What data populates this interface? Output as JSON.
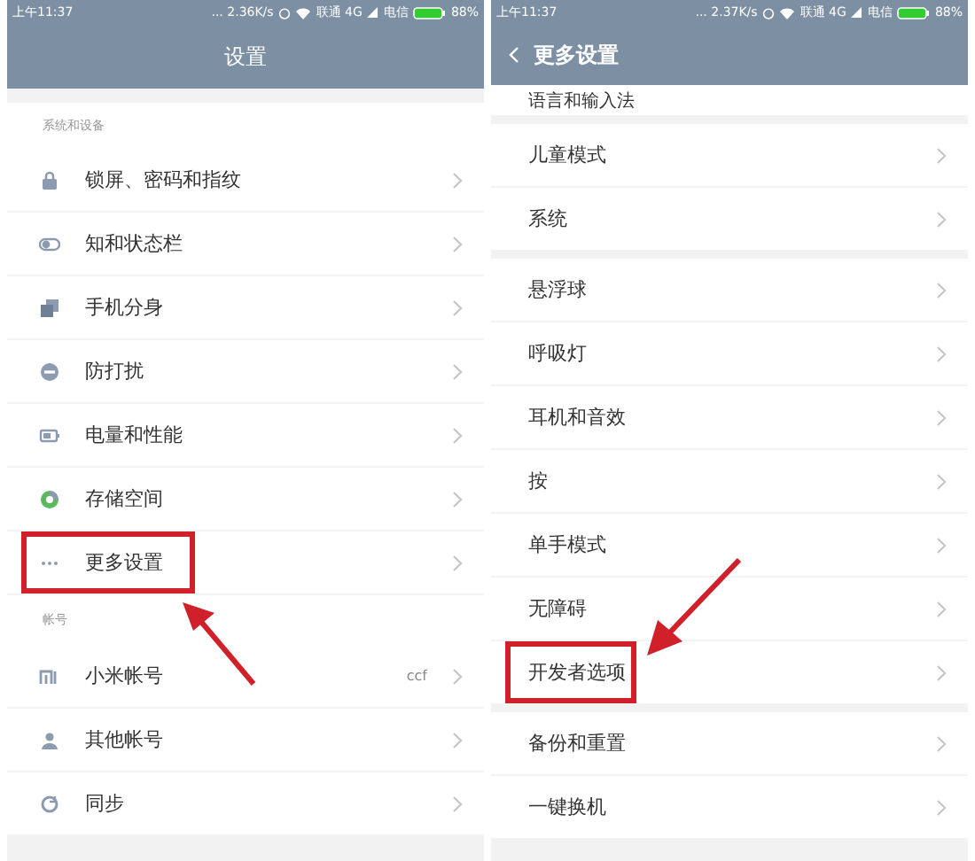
{
  "panels": [
    {
      "status_bar": {
        "time": "上午11:37",
        "speed": "... 2.36K/s",
        "carrier_1": "联通 4G",
        "carrier_2": "电信",
        "battery": "88%"
      },
      "header": {
        "title": "设置",
        "back": false
      },
      "groups": [
        {
          "heading": "系统和设备",
          "cut": false,
          "items": [
            {
              "label": "锁屏、密码和指纹",
              "highlighted": false
            },
            {
              "label": "知和状态栏",
              "highlighted": false
            },
            {
              "label": "手机分身",
              "highlighted": false
            },
            {
              "label": "防打扰",
              "highlighted": false
            },
            {
              "label": "电量和性能",
              "highlighted": false
            },
            {
              "label": "存储空间",
              "highlighted": false
            },
            {
              "label": "更多设置",
              "highlighted": true
            }
          ]
        },
        {
          "heading": "帐号",
          "cut": false,
          "items": [
            {
              "label": "小米帐号",
              "value": "ccf",
              "highlighted": false
            },
            {
              "label": "其他帐号",
              "highlighted": false
            },
            {
              "label": "同步",
              "highlighted": false
            }
          ]
        }
      ]
    },
    {
      "status_bar": {
        "time": "上午11:37",
        "speed": "... 2.37K/s",
        "carrier_1": "联通 4G",
        "carrier_2": "电信",
        "battery": "88%"
      },
      "header": {
        "title": "更多设置",
        "back": true
      },
      "groups": [
        {
          "cut": true,
          "items": [
            {
              "label": "语言和输入法",
              "highlighted": false
            }
          ]
        },
        {
          "cut": false,
          "items": [
            {
              "label": "儿童模式",
              "highlighted": false
            },
            {
              "label": "系统",
              "highlighted": false
            }
          ]
        },
        {
          "cut": false,
          "items": [
            {
              "label": "悬浮球",
              "highlighted": false
            },
            {
              "label": "呼吸灯",
              "highlighted": false
            },
            {
              "label": "耳机和音效",
              "highlighted": false
            },
            {
              "label": "按",
              "highlighted": false
            },
            {
              "label": "单手模式",
              "highlighted": false
            },
            {
              "label": "无障碍",
              "highlighted": false
            },
            {
              "label": "开发者选项",
              "highlighted": true
            }
          ]
        },
        {
          "cut": false,
          "items": [
            {
              "label": "备份和重置",
              "highlighted": false
            },
            {
              "label": "一键换机",
              "highlighted": false
            }
          ]
        }
      ]
    }
  ]
}
